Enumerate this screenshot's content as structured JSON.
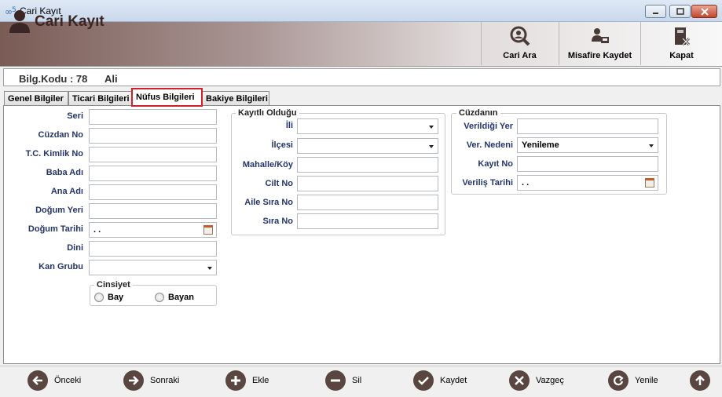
{
  "window": {
    "title": "Cari Kayıt"
  },
  "header": {
    "title": "Cari Kayıt",
    "buttons": {
      "ara": "Cari Ara",
      "misafir": "Misafire Kaydet",
      "kapat": "Kapat"
    }
  },
  "info": {
    "code": "Bilg.Kodu : 78",
    "name": "Ali"
  },
  "tabs": {
    "genel": "Genel Bilgiler",
    "ticari": "Ticari Bilgileri",
    "nufus": "Nüfus Bilgileri",
    "bakiye": "Bakiye Bilgileri"
  },
  "nufus": {
    "labels": {
      "seri": "Seri",
      "cuzdan_no": "Cüzdan No",
      "tc": "T.C. Kimlik No",
      "baba": "Baba Adı",
      "ana": "Ana Adı",
      "dogum_yeri": "Doğum Yeri",
      "dogum_tarihi": "Doğum Tarihi",
      "dini": "Dini",
      "kan": "Kan Grubu"
    },
    "values": {
      "dogum_tarihi": ". ."
    },
    "cinsiyet": {
      "title": "Cinsiyet",
      "bay": "Bay",
      "bayan": "Bayan"
    },
    "kayitli": {
      "title": "Kayıtlı Olduğu",
      "ili": "İli",
      "ilcesi": "İlçesi",
      "mahalle": "Mahalle/Köy",
      "cilt": "Cilt No",
      "aile": "Aile Sıra No",
      "sira": "Sıra No"
    },
    "cuzdan": {
      "title": "Cüzdanın",
      "verildigi": "Verildiği Yer",
      "neden": "Ver. Nedeni",
      "neden_value": "Yenileme",
      "kayit": "Kayıt No",
      "tarih": "Veriliş Tarihi",
      "tarih_value": ". ."
    }
  },
  "nav": {
    "onceki": "Önceki",
    "sonraki": "Sonraki",
    "ekle": "Ekle",
    "sil": "Sil",
    "kaydet": "Kaydet",
    "vazgec": "Vazgeç",
    "yenile": "Yenile"
  },
  "colors": {
    "label": "#23356b",
    "header_dark": "#7a5b55",
    "highlight": "#d0202a",
    "icon_bg": "#5a4640"
  }
}
